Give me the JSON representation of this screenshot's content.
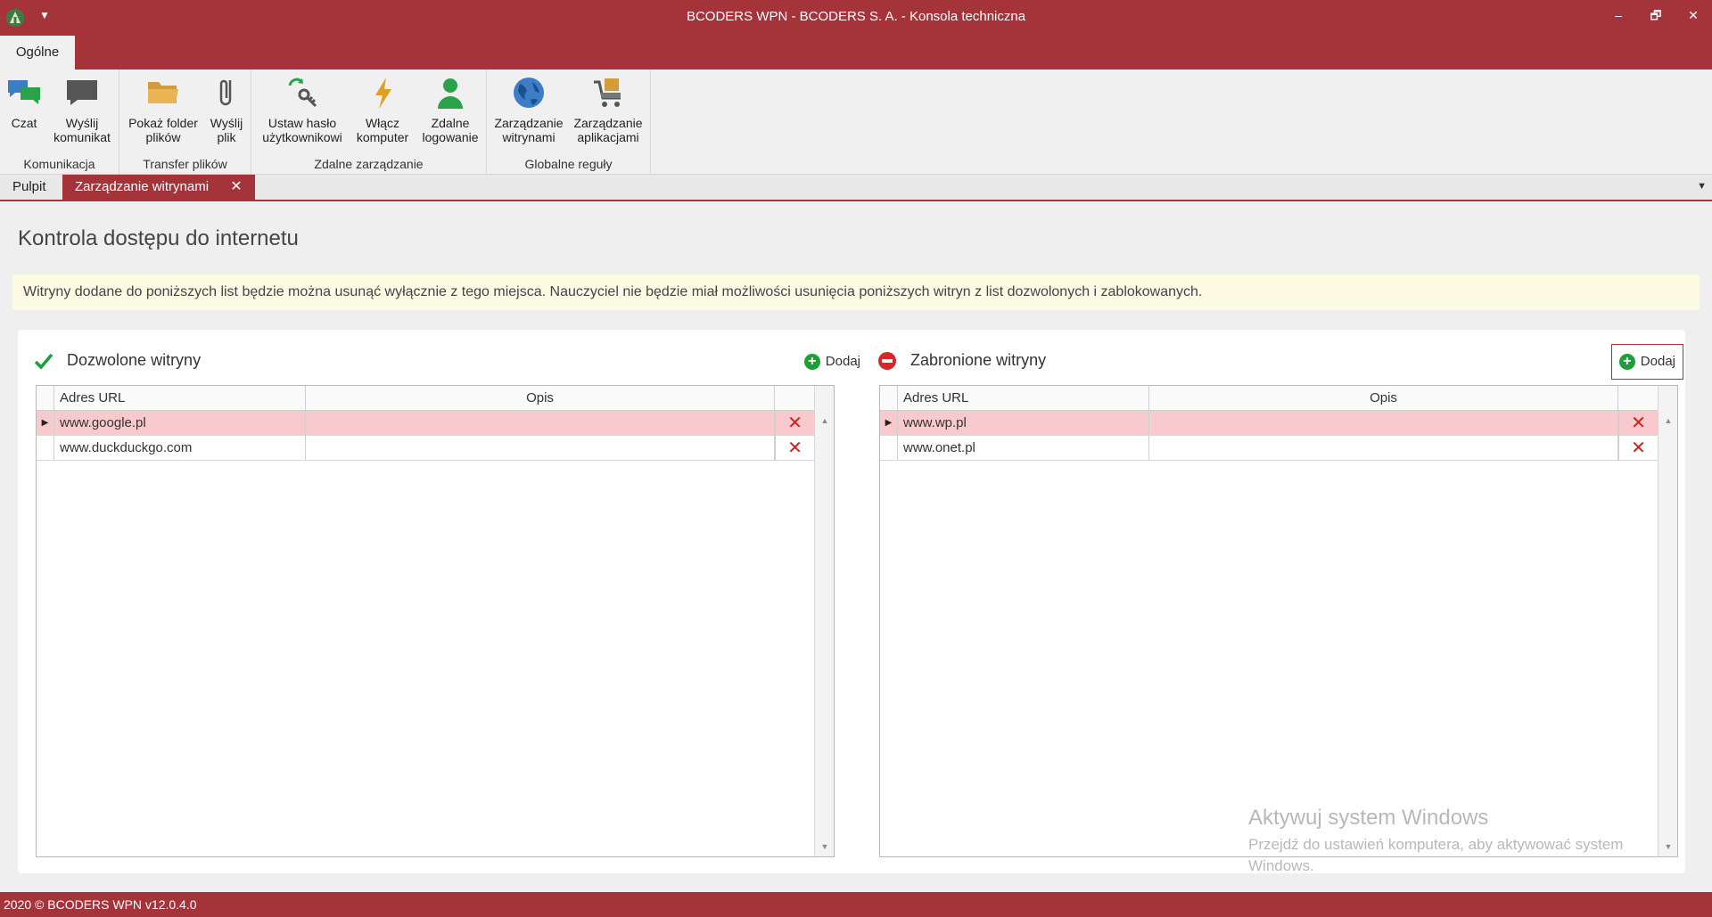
{
  "window": {
    "title": "BCODERS WPN - BCODERS S. A. - Konsola techniczna",
    "controls": {
      "minimize": "–",
      "restore": "🗗",
      "close": "✕"
    },
    "brand_color": "#a4343a"
  },
  "ribbon": {
    "tab": "Ogólne",
    "groups": [
      {
        "caption": "Komunikacja",
        "buttons": [
          {
            "label": "Czat",
            "icon": "chat-icon"
          },
          {
            "label": "Wyślij komunikat",
            "icon": "message-icon"
          }
        ]
      },
      {
        "caption": "Transfer plików",
        "buttons": [
          {
            "label": "Pokaż folder plików",
            "icon": "folder-icon"
          },
          {
            "label": "Wyślij plik",
            "icon": "paperclip-icon"
          }
        ]
      },
      {
        "caption": "Zdalne zarządzanie",
        "buttons": [
          {
            "label": "Ustaw hasło użytkownikowi",
            "icon": "key-refresh-icon"
          },
          {
            "label": "Włącz komputer",
            "icon": "lightning-icon"
          },
          {
            "label": "Zdalne logowanie",
            "icon": "user-icon"
          }
        ]
      },
      {
        "caption": "Globalne reguły",
        "buttons": [
          {
            "label": "Zarządzanie witrynami",
            "icon": "globe-icon"
          },
          {
            "label": "Zarządzanie aplikacjami",
            "icon": "cart-icon"
          }
        ]
      }
    ]
  },
  "doc_tabs": [
    {
      "label": "Pulpit",
      "active": false
    },
    {
      "label": "Zarządzanie witrynami",
      "active": true,
      "close": "✕"
    }
  ],
  "page": {
    "title": "Kontrola dostępu do internetu",
    "info": "Witryny dodane do poniższych list będzie można usunąć wyłącznie z tego miejsca. Nauczyciel nie będzie miał możliwości usunięcia poniższych witryn z list dozwolonych i zablokowanych."
  },
  "allowed": {
    "title": "Dozwolone witryny",
    "add_label": "Dodaj",
    "columns": [
      "Adres URL",
      "Opis"
    ],
    "rows": [
      {
        "url": "www.google.pl",
        "desc": ""
      },
      {
        "url": "www.duckduckgo.com",
        "desc": ""
      }
    ]
  },
  "blocked": {
    "title": "Zabronione witryny",
    "add_label": "Dodaj",
    "columns": [
      "Adres URL",
      "Opis"
    ],
    "rows": [
      {
        "url": "www.wp.pl",
        "desc": ""
      },
      {
        "url": "www.onet.pl",
        "desc": ""
      }
    ]
  },
  "watermark": {
    "line1": "Aktywuj system Windows",
    "line2": "Przejdź do ustawień komputera, aby aktywować system Windows."
  },
  "status": {
    "text": "2020 ©  BCODERS WPN v12.0.4.0"
  }
}
